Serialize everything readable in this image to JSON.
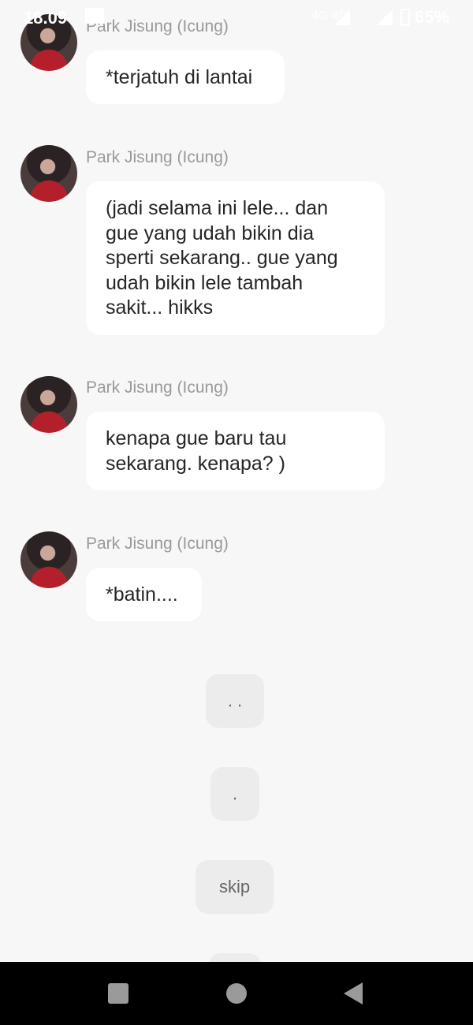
{
  "status_bar": {
    "time": "18.09",
    "network": "4G  4G",
    "battery": "65%"
  },
  "messages": [
    {
      "sender": "Park Jisung (Icung)",
      "lines": [
        "*terjatuh di lantai"
      ]
    },
    {
      "sender": "Park Jisung (Icung)",
      "lines": [
        "(jadi selama ini lele... dan",
        "gue yang udah bikin dia",
        "sperti sekarang.. gue yang",
        "udah bikin lele tambah",
        "sakit... hikks"
      ]
    },
    {
      "sender": "Park Jisung (Icung)",
      "lines": [
        "kenapa gue baru tau",
        "sekarang. kenapa? )"
      ]
    },
    {
      "sender": "Park Jisung (Icung)",
      "lines": [
        "*batin...."
      ]
    }
  ],
  "choices": [
    ". .",
    ".",
    "skip",
    ""
  ],
  "colors": {
    "background": "#f7f7f7",
    "bubble": "#ffffff",
    "choice": "#ececec",
    "sender_text": "#9a9a9a"
  },
  "icons": {
    "nav_recents": "square-icon",
    "nav_home": "circle-icon",
    "nav_back": "triangle-back-icon",
    "status_signal": "signal-icon",
    "status_battery": "battery-icon"
  }
}
